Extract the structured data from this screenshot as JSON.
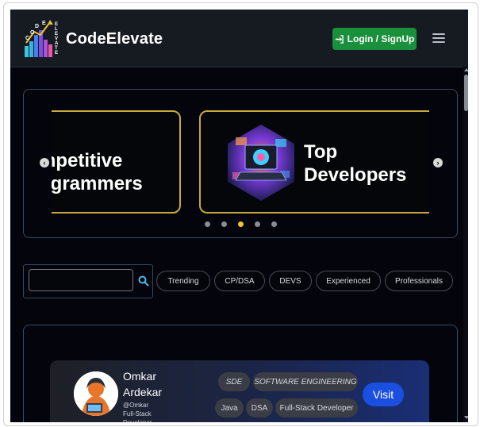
{
  "navbar": {
    "logo_letters": [
      "C",
      "O",
      "D",
      "E",
      "E",
      "L",
      "E",
      "V",
      "A",
      "T",
      "E"
    ],
    "brand": "CodeElevate",
    "login_label": "Login / SignUp",
    "login_icon": "sign-in-icon",
    "menu_icon": "hamburger-menu-icon"
  },
  "carousel": {
    "slides": [
      {
        "title": "p\nmpetitive\nogrammers"
      },
      {
        "title": "Top\nDevelopers",
        "image": "laptop-hexagon-illustration"
      }
    ],
    "prev_label": "‹",
    "next_label": "›",
    "dot_count": 5,
    "active_dot": 2
  },
  "filters": {
    "search_placeholder": "",
    "search_value": "",
    "search_icon": "search-icon",
    "chips": [
      "Trending",
      "CP/DSA",
      "DEVS",
      "Experienced",
      "Professionals"
    ]
  },
  "profile_card": {
    "name": "Omkar Ardekar",
    "handle": "@Omkar",
    "role": "Full-Stack Developer",
    "tags_row1": [
      "SDE",
      "SOFTWARE ENGINEERING"
    ],
    "tags_row2": [
      "Java",
      "DSA",
      "Full-Stack Developer"
    ],
    "visit_label": "Visit"
  },
  "colors": {
    "background": "#03040c",
    "navbar": "#161b22",
    "login_green": "#1a8f3c",
    "slide_border": "#c8a93a",
    "active_dot": "#f0c330",
    "visit_blue": "#1a4fe0"
  }
}
